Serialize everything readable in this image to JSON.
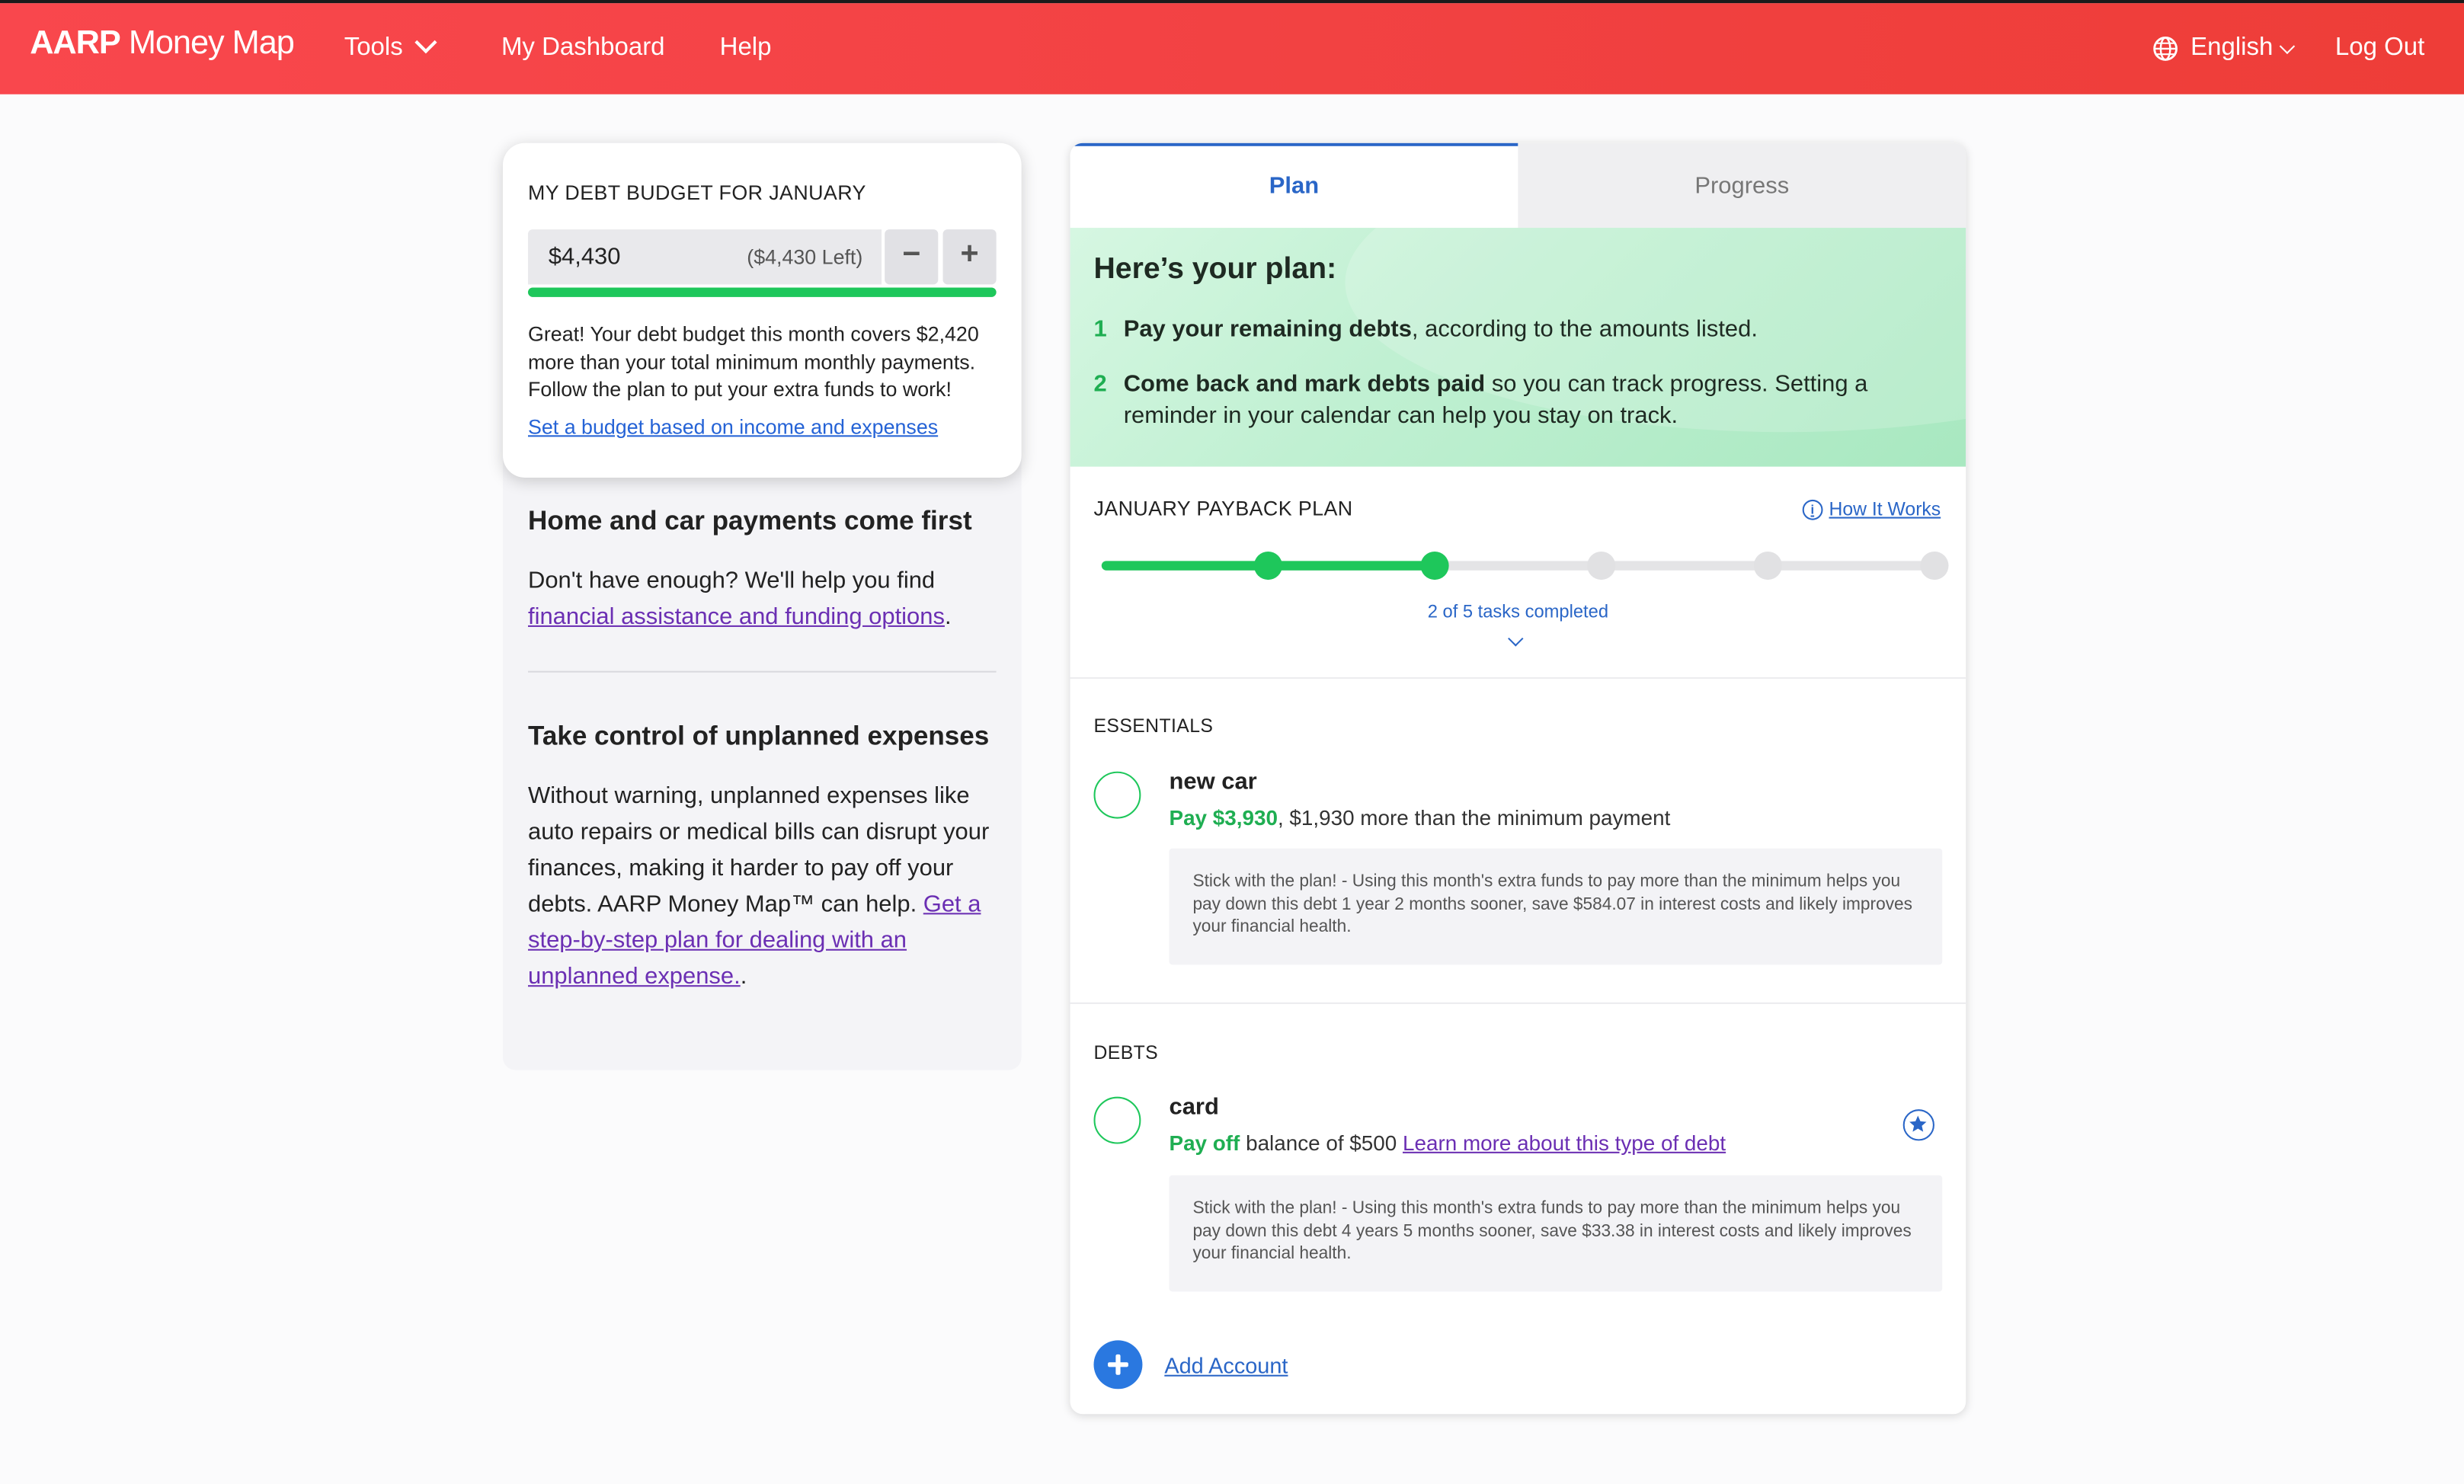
{
  "header": {
    "logo_bold": "AARP",
    "logo_rest": " Money Map",
    "nav": {
      "tools": "Tools",
      "dashboard": "My Dashboard",
      "help": "Help"
    },
    "language": "English",
    "logout": "Log Out"
  },
  "budget": {
    "title": "MY DEBT BUDGET FOR JANUARY",
    "amount": "$4,430",
    "left": "($4,430 Left)",
    "minus": "−",
    "plus": "+",
    "fill_fraction": 1.0,
    "message": "Great! Your debt budget this month covers $2,420 more than your total minimum monthly payments. Follow the plan to put your extra funds to work!",
    "link": "Set a budget based on income and expenses"
  },
  "info": {
    "section1_title": "Home and car payments come first",
    "section1_text": "Don't have enough? We'll help you find ",
    "section1_link": "financial assistance and funding options",
    "section1_end": ".",
    "section2_title": "Take control of unplanned expenses",
    "section2_text": "Without warning, unplanned expenses like auto repairs or medical bills can disrupt your finances, making it harder to pay off your debts. AARP Money Map™ can help. ",
    "section2_link": "Get a step-by-step plan for dealing with an unplanned expense.",
    "section2_end": "."
  },
  "plan": {
    "tabs": {
      "plan": "Plan",
      "progress": "Progress"
    },
    "hero_title": "Here’s your plan:",
    "steps": [
      {
        "num": "1",
        "bold": "Pay your remaining debts",
        "rest": ", according to the amounts listed."
      },
      {
        "num": "2",
        "bold": "Come back and mark debts paid",
        "rest": " so you can track progress. Setting a reminder in your calendar can help you stay on track."
      }
    ],
    "payback_title": "JANUARY PAYBACK PLAN",
    "how_it_works": "How It Works",
    "tasks_completed": 2,
    "tasks_total": 5,
    "tasks_text": "2 of 5 tasks completed",
    "essentials_label": "ESSENTIALS",
    "debts_label": "DEBTS",
    "accounts": [
      {
        "name": "new car",
        "pay": "Pay $3,930",
        "detail": ", $1,930 more than the minimum payment",
        "note": "Stick with the plan! - Using this month's extra funds to pay more than the minimum helps you pay down this debt 1 year 2 months sooner, save $584.07 in interest costs and likely improves your financial health."
      },
      {
        "name": "card",
        "pay": "Pay off",
        "detail": " balance of $500 ",
        "link": "Learn more about this type of debt",
        "note": "Stick with the plan! - Using this month's extra funds to pay more than the minimum helps you pay down this debt 4 years 5 months sooner, save $33.38 in interest costs and likely improves your financial health."
      }
    ],
    "add_account": "Add Account"
  },
  "colors": {
    "brand_red": "#f14141",
    "accent_blue": "#2a66c7",
    "success_green": "#1ec75b",
    "link_purple": "#6b2fb3"
  }
}
